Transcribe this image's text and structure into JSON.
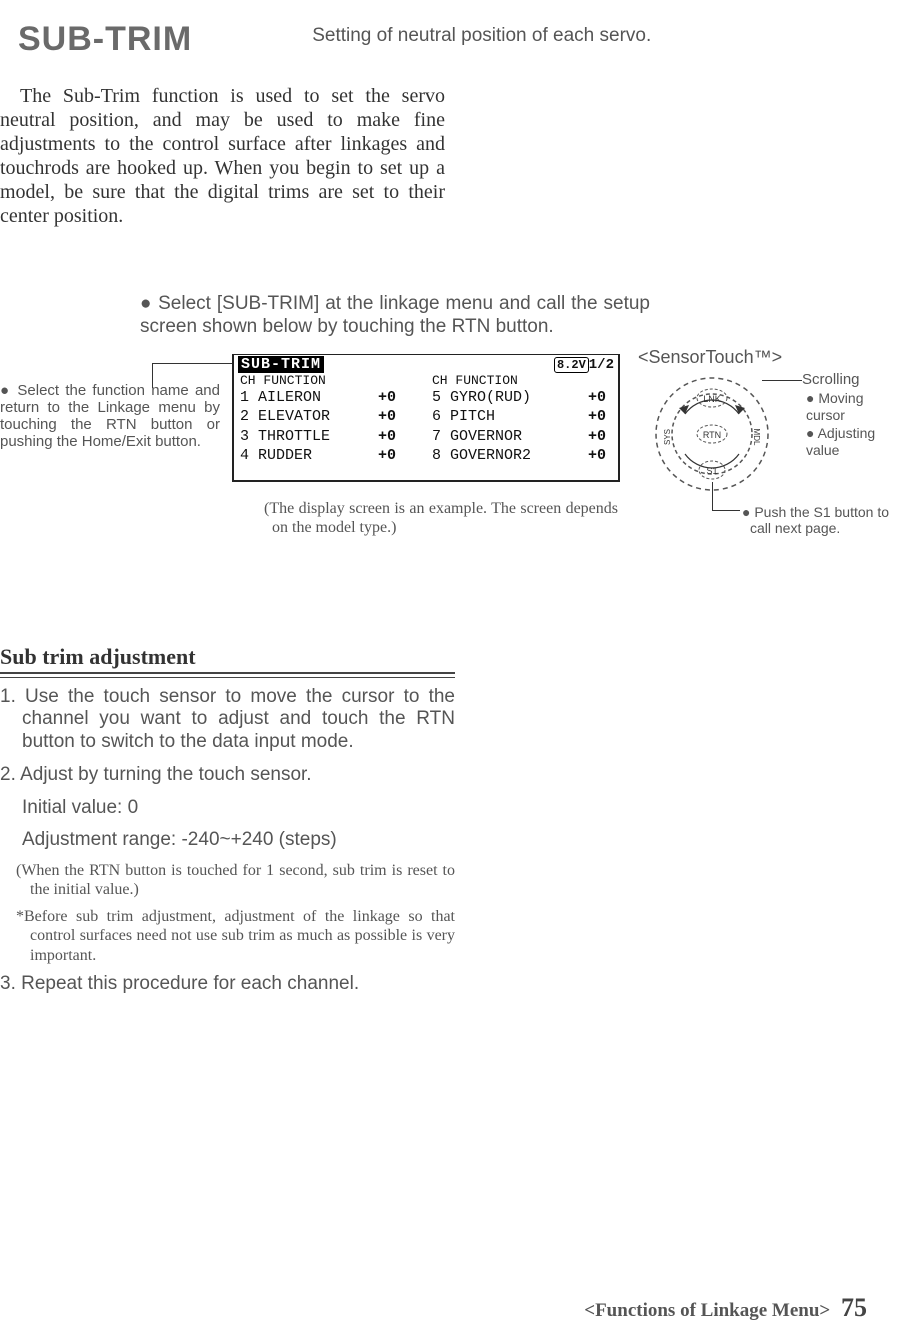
{
  "title": "SUB-TRIM",
  "subtitle": "Setting of neutral position of each servo.",
  "intro": "The Sub-Trim function is used to set the servo neutral position, and may be used to make fine adjustments to the control surface after linkages and touchrods are hooked up. When you begin to set up a model, be sure that the digital trims are set to their center position.",
  "select_instruction": "● Select [SUB-TRIM] at the linkage menu and call the setup screen shown below by touching the RTN button.",
  "side_note_left": "● Select the function name and return to the Linkage menu by touching the RTN button or pushing the Home/Exit button.",
  "lcd": {
    "screen_title": "SUB-TRIM",
    "battery": "8.2V",
    "page": "1/2",
    "col_header": "CH FUNCTION",
    "rows_left": [
      {
        "n": "1",
        "name": "AILERON",
        "val": "+0"
      },
      {
        "n": "2",
        "name": "ELEVATOR",
        "val": "+0"
      },
      {
        "n": "3",
        "name": "THROTTLE",
        "val": "+0"
      },
      {
        "n": "4",
        "name": "RUDDER",
        "val": "+0"
      }
    ],
    "rows_right": [
      {
        "n": "5",
        "name": "GYRO(RUD)",
        "val": "+0"
      },
      {
        "n": "6",
        "name": "PITCH",
        "val": "+0"
      },
      {
        "n": "7",
        "name": "GOVERNOR",
        "val": "+0"
      },
      {
        "n": "8",
        "name": "GOVERNOR2",
        "val": "+0"
      }
    ]
  },
  "lcd_under_note": "(The display screen is an example. The screen depends on the model type.)",
  "sensor": {
    "title": "<SensorTouch™>",
    "scrolling": "Scrolling",
    "b1": "● Moving cursor",
    "b2": "● Adjusting value",
    "s1": "● Push the S1 button to call next page.",
    "labels": {
      "lnk": "LNK",
      "rtn": "RTN",
      "s1btn": "S1",
      "sys": "SYS",
      "mdl": "MDL"
    }
  },
  "section2": {
    "title": "Sub trim adjustment",
    "step1": "1. Use the touch sensor to move the cursor to the channel you want to adjust and touch the RTN button to switch to the data input mode.",
    "step2": "2. Adjust by turning the touch sensor.",
    "initial": "Initial value: 0",
    "range": "Adjustment range: -240~+240 (steps)",
    "note1": "(When the RTN button is touched for 1 second, sub trim is reset to the initial value.)",
    "note2": "*Before sub trim adjustment, adjustment of the linkage so that control surfaces need not use sub trim as much as possible is very important.",
    "step3": "3. Repeat this procedure for each channel."
  },
  "footer": {
    "label": "<Functions of Linkage Menu>",
    "page": "75"
  }
}
